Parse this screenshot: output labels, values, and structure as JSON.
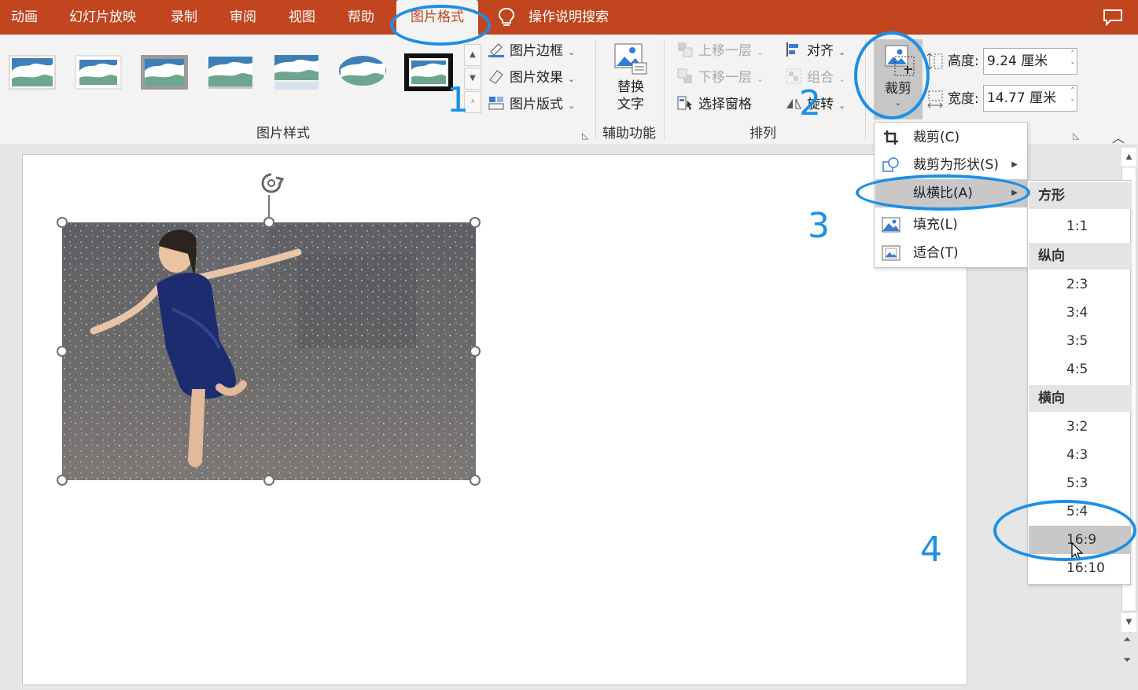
{
  "tabs": [
    {
      "label": "动画"
    },
    {
      "label": "幻灯片放映"
    },
    {
      "label": "录制"
    },
    {
      "label": "审阅"
    },
    {
      "label": "视图"
    },
    {
      "label": "帮助"
    },
    {
      "label": "图片格式"
    }
  ],
  "tell_me": "操作说明搜索",
  "ribbon": {
    "picture_styles": {
      "group_label": "图片样式",
      "border": "图片边框",
      "effects": "图片效果",
      "layout": "图片版式"
    },
    "accessibility": {
      "group_label": "辅助功能",
      "alt_text_line1": "替换",
      "alt_text_line2": "文字"
    },
    "arrange": {
      "group_label": "排列",
      "bring_forward": "上移一层",
      "send_backward": "下移一层",
      "selection_pane": "选择窗格",
      "align": "对齐",
      "group": "组合",
      "rotate": "旋转"
    },
    "size": {
      "crop": "裁剪",
      "height_label": "高度:",
      "height_value": "9.24 厘米",
      "width_label": "宽度:",
      "width_value": "14.77 厘米"
    }
  },
  "crop_menu": {
    "items": [
      {
        "label": "裁剪(C)"
      },
      {
        "label": "裁剪为形状(S)"
      },
      {
        "label": "纵横比(A)"
      },
      {
        "label": "填充(L)"
      },
      {
        "label": "适合(T)"
      }
    ]
  },
  "aspect_submenu": {
    "sections": [
      {
        "title": "方形",
        "options": [
          "1:1"
        ]
      },
      {
        "title": "纵向",
        "options": [
          "2:3",
          "3:4",
          "3:5",
          "4:5"
        ]
      },
      {
        "title": "横向",
        "options": [
          "3:2",
          "4:3",
          "5:3",
          "5:4",
          "16:9",
          "16:10"
        ]
      }
    ],
    "selected": "16:9"
  },
  "annotations": [
    "1",
    "2",
    "3",
    "4"
  ],
  "colors": {
    "accent": "#c1451f",
    "annotation": "#1c8fe6",
    "ribbon_bg": "#f3f3f3"
  }
}
